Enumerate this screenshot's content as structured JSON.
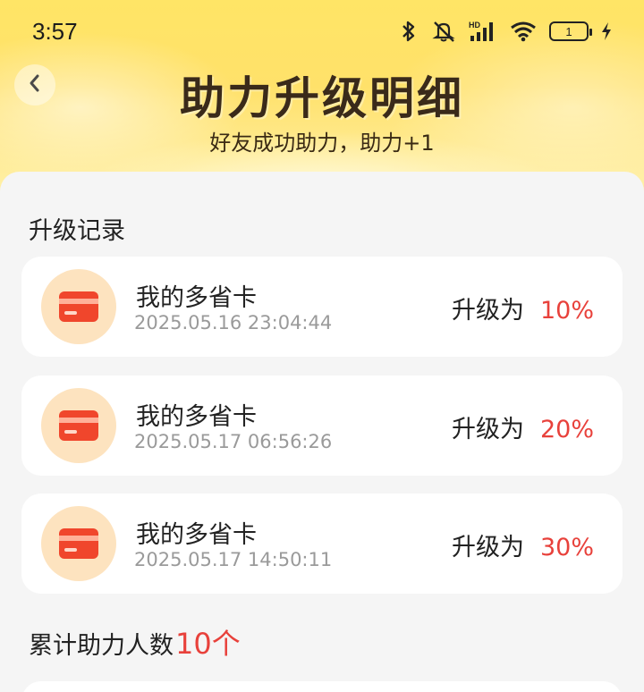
{
  "status_bar": {
    "time": "3:57",
    "battery": "1"
  },
  "header": {
    "title": "助力升级明细",
    "subtitle": "好友成功助力，助力+1"
  },
  "records": {
    "section_title": "升级记录",
    "items": [
      {
        "name": "我的多省卡",
        "date": "2025.05.16 23:04:44",
        "upgrade_label": "升级为",
        "percent": "10%"
      },
      {
        "name": "我的多省卡",
        "date": "2025.05.17 06:56:26",
        "upgrade_label": "升级为",
        "percent": "20%"
      },
      {
        "name": "我的多省卡",
        "date": "2025.05.17 14:50:11",
        "upgrade_label": "升级为",
        "percent": "30%"
      }
    ]
  },
  "total": {
    "label": "累计助力人数",
    "count": "10个"
  },
  "colors": {
    "accent_red": "#e8413b",
    "header_yellow": "#ffe566",
    "card_icon_bg": "#fde3bf",
    "card_icon_fg": "#f0462c"
  },
  "icons": {
    "back": "chevron-left-icon",
    "card": "card-icon",
    "bluetooth": "bluetooth-icon",
    "mute": "mute-icon",
    "signal": "signal-icon",
    "wifi": "wifi-icon",
    "charging": "charging-icon"
  }
}
